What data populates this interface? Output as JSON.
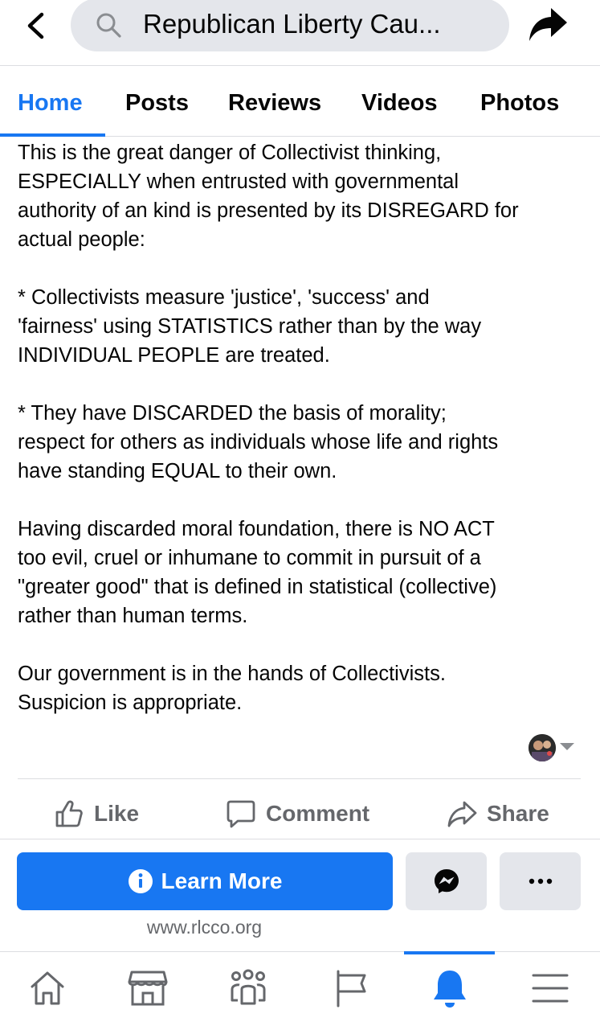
{
  "header": {
    "search_text": "Republican Liberty Cau...",
    "icons": [
      "back-chevron-icon",
      "search-icon",
      "share-arrow-icon"
    ]
  },
  "tabs": [
    {
      "label": "Home",
      "active": true
    },
    {
      "label": "Posts",
      "active": false
    },
    {
      "label": "Reviews",
      "active": false
    },
    {
      "label": "Videos",
      "active": false
    },
    {
      "label": "Photos",
      "active": false
    }
  ],
  "post": {
    "paragraphs": [
      "This is the great danger of Collectivist thinking,\nESPECIALLY when entrusted with governmental\nauthority of an kind is presented by its DISREGARD for\nactual people:",
      "*  Collectivists measure 'justice', 'success' and\n'fairness' using STATISTICS rather than by the way\nINDIVIDUAL PEOPLE are treated.",
      "*  They have DISCARDED the basis of morality;\nrespect for others as individuals whose life and rights\nhave standing EQUAL to their own.",
      "Having discarded moral foundation, there is NO ACT\ntoo evil, cruel or inhumane to commit in pursuit of a\n\"greater good\" that is defined in statistical (collective)\nrather than human terms.",
      "Our government is in the hands of Collectivists.\nSuspicion is appropriate."
    ]
  },
  "actions": {
    "like": "Like",
    "comment": "Comment",
    "share": "Share"
  },
  "cta": {
    "label": "Learn More",
    "url": "www.rlcco.org"
  },
  "bottom_nav": {
    "items": [
      "home-icon",
      "marketplace-icon",
      "groups-icon",
      "pages-flag-icon",
      "notifications-bell-icon",
      "menu-icon"
    ],
    "active": "notifications-bell-icon"
  },
  "colors": {
    "accent": "#1877f2",
    "secondary_text": "#65676b",
    "button_gray": "#e4e6eb"
  }
}
